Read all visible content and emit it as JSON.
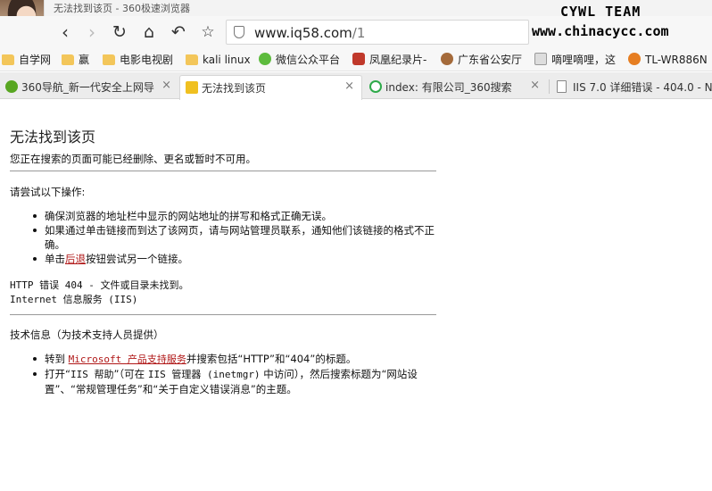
{
  "window": {
    "title": "无法找到该页 - 360极速浏览器",
    "watermark_line1": "CYWL TEAM",
    "watermark_line2": "www.chinacycc.com"
  },
  "toolbar": {
    "back_glyph": "‹",
    "forward_glyph": "›",
    "reload_glyph": "↻",
    "home_glyph": "⌂",
    "undo_glyph": "↶",
    "star_glyph": "☆",
    "url_host": "www.iq58.com",
    "url_path": "/1"
  },
  "bookmarks": [
    {
      "label": "自学网",
      "icon": "folder-icon"
    },
    {
      "label": "赢",
      "icon": "folder-icon"
    },
    {
      "label": "电影电视剧",
      "icon": "folder-icon"
    },
    {
      "label": "kali linux",
      "icon": "folder-icon"
    },
    {
      "label": "微信公众平台",
      "icon": "wechat-icon"
    },
    {
      "label": "凤凰纪录片-",
      "icon": "phoenix-icon"
    },
    {
      "label": "广东省公安厅",
      "icon": "police-icon"
    },
    {
      "label": "嘀哩嘀哩，这",
      "icon": "face-icon"
    },
    {
      "label": "TL-WR886N",
      "icon": "tplink-icon"
    }
  ],
  "tabs": [
    {
      "label": "360导航_新一代安全上网导",
      "icon": "360-icon",
      "close": "×",
      "active": false
    },
    {
      "label": "无法找到该页",
      "icon": "warning-icon",
      "close": "×",
      "active": true
    },
    {
      "label": "index: 有限公司_360搜索",
      "icon": "search-icon",
      "close": "×",
      "active": false
    },
    {
      "label": "IIS 7.0 详细错误 - 404.0 - N",
      "icon": "page-icon",
      "close": "",
      "active": false
    }
  ],
  "page": {
    "title": "无法找到该页",
    "subtitle": "您正在搜索的页面可能已经删除、更名或暂时不可用。",
    "try_label": "请尝试以下操作:",
    "try_items": {
      "item1": "确保浏览器的地址栏中显示的网站地址的拼写和格式正确无误。",
      "item2": "如果通过单击链接而到达了该网页，请与网站管理员联系，通知他们该链接的格式不正确。",
      "item3_prefix": "单击",
      "item3_link": "后退",
      "item3_suffix": "按钮尝试另一个链接。"
    },
    "error_line1": "HTTP 错误 404 - 文件或目录未找到。",
    "error_line2": "Internet 信息服务 (IIS)",
    "tech_label": "技术信息（为技术支持人员提供）",
    "tech_items": {
      "item1_prefix": "转到 ",
      "item1_link": "Microsoft 产品支持服务",
      "item1_suffix": "并搜索包括“HTTP”和“404”的标题。",
      "item2_a": "打开“",
      "item2_b": "IIS 帮助",
      "item2_c": "”（可在 ",
      "item2_d": "IIS 管理器 (inetmgr)",
      "item2_e": " 中访问），然后搜索标题为“网站设置”、“常规管理任务”和“关于自定义错误消息”的主题。"
    }
  }
}
